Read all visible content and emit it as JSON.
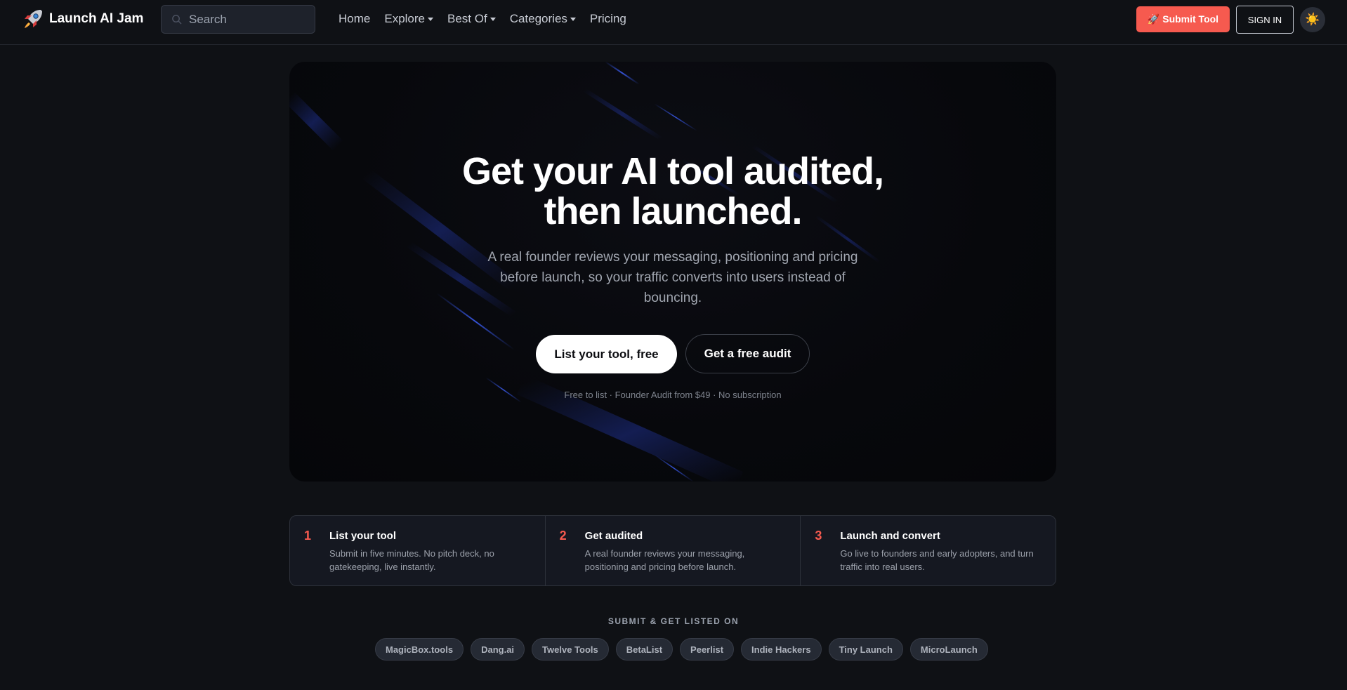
{
  "nav": {
    "brand": "Launch AI Jam",
    "search_placeholder": "Search",
    "items": [
      {
        "label": "Home",
        "dropdown": false
      },
      {
        "label": "Explore",
        "dropdown": true
      },
      {
        "label": "Best Of",
        "dropdown": true
      },
      {
        "label": "Categories",
        "dropdown": true
      },
      {
        "label": "Pricing",
        "dropdown": false
      }
    ],
    "submit_label": "🚀 Submit Tool",
    "signin_label": "SIGN IN",
    "theme_icon": "☀️"
  },
  "hero": {
    "title_line1": "Get your AI tool audited,",
    "title_line2": "then launched.",
    "subtitle": "A real founder reviews your messaging, positioning and pricing before launch, so your traffic converts into users instead of bouncing.",
    "primary_cta": "List your tool, free",
    "secondary_cta": "Get a free audit",
    "note": "Free to list · Founder Audit from $49 · No subscription"
  },
  "steps": [
    {
      "num": "1",
      "title": "List your tool",
      "desc": "Submit in five minutes. No pitch deck, no gatekeeping, live instantly."
    },
    {
      "num": "2",
      "title": "Get audited",
      "desc": "A real founder reviews your messaging, positioning and pricing before launch."
    },
    {
      "num": "3",
      "title": "Launch and convert",
      "desc": "Go live to founders and early adopters, and turn traffic into real users."
    }
  ],
  "listed": {
    "label": "SUBMIT & GET LISTED ON",
    "sites": [
      "MagicBox.tools",
      "Dang.ai",
      "Twelve Tools",
      "BetaList",
      "Peerlist",
      "Indie Hackers",
      "Tiny Launch",
      "MicroLaunch"
    ]
  },
  "colors": {
    "accent": "#f65a4f",
    "background": "#0f1115",
    "hero_bg": "#07080c",
    "streak": "#2f4fd8"
  }
}
